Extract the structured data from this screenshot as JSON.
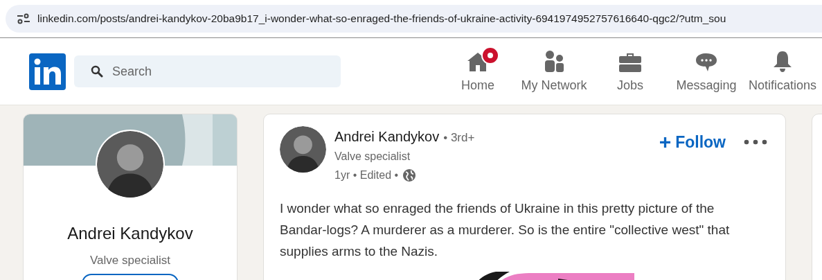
{
  "address_bar": {
    "url": "linkedin.com/posts/andrei-kandykov-20ba9b17_i-wonder-what-so-enraged-the-friends-of-ukraine-activity-6941974952757616640-qgc2/?utm_sou"
  },
  "nav": {
    "search": {
      "placeholder": "Search"
    },
    "items": [
      {
        "kind": "home",
        "label": "Home",
        "notification_dot": true
      },
      {
        "kind": "network",
        "label": "My Network",
        "notification_dot": false
      },
      {
        "kind": "jobs",
        "label": "Jobs",
        "notification_dot": false
      },
      {
        "kind": "messaging",
        "label": "Messaging",
        "notification_dot": false
      },
      {
        "kind": "notifications",
        "label": "Notifications",
        "notification_dot": false
      }
    ]
  },
  "profile_card": {
    "name": "Andrei Kandykov",
    "headline": "Valve specialist"
  },
  "post": {
    "author": "Andrei Kandykov",
    "degree": "• 3rd+",
    "headline": "Valve specialist",
    "meta": "1yr • Edited •",
    "follow": "Follow",
    "follow_icon": "+",
    "text": "I wonder what so enraged the friends of Ukraine in this pretty picture of the Bandar-logs? A murderer as a murderer. So is the entire \"collective west\" that supplies arms to the Nazis."
  }
}
